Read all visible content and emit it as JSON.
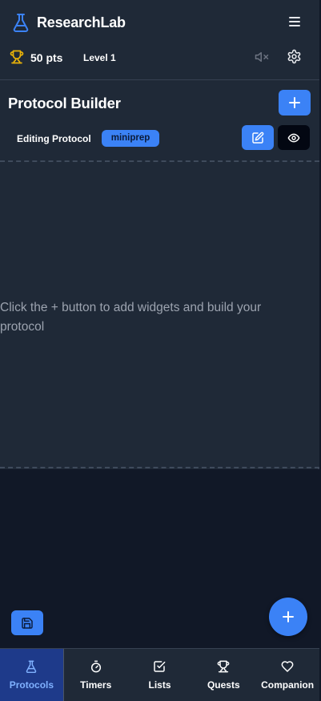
{
  "header": {
    "app_title": "ResearchLab",
    "points": "50 pts",
    "level": "Level 1",
    "icons": [
      "flask-icon",
      "menu-icon",
      "trophy-icon",
      "mute-icon",
      "settings-icon"
    ]
  },
  "builder": {
    "title": "Protocol Builder",
    "editing_label": "Editing Protocol",
    "protocol_name": "miniprep",
    "empty_message": "Click the + button to add widgets and build your protocol"
  },
  "nav": {
    "items": [
      {
        "label": "Protocols",
        "icon": "flask-icon",
        "active": true
      },
      {
        "label": "Timers",
        "icon": "stopwatch-icon",
        "active": false
      },
      {
        "label": "Lists",
        "icon": "checkbox-icon",
        "active": false
      },
      {
        "label": "Quests",
        "icon": "trophy-icon",
        "active": false
      },
      {
        "label": "Companion",
        "icon": "heart-icon",
        "active": false
      }
    ]
  },
  "colors": {
    "accent": "#3b82f6",
    "panel": "#1f2937",
    "background": "#111827",
    "trophy": "#eab308",
    "nav_active_bg": "#1e3a8a"
  }
}
